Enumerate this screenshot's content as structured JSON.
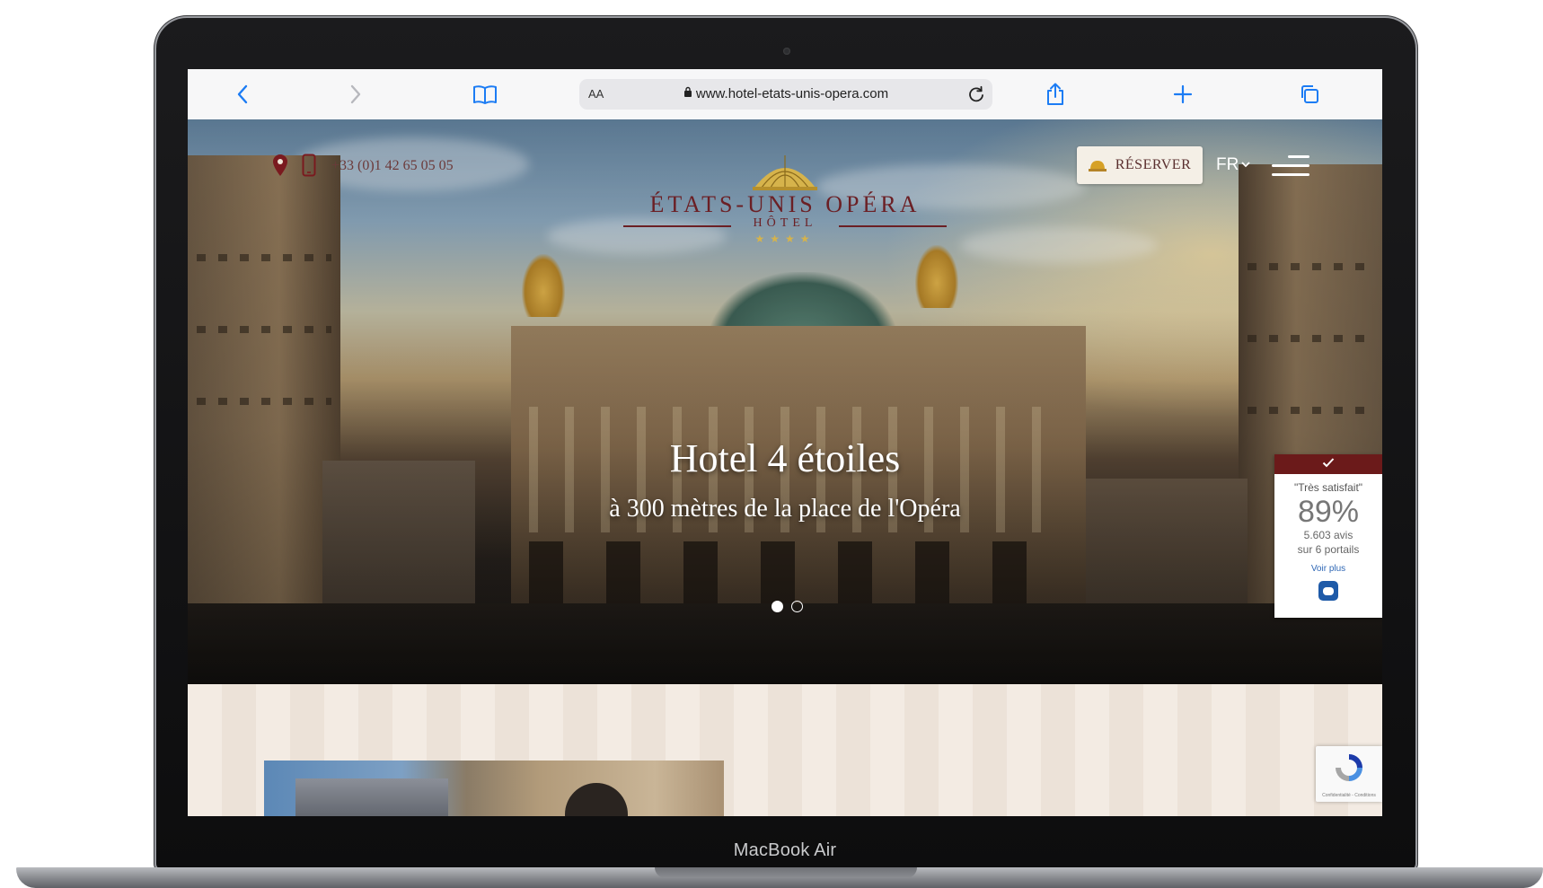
{
  "device": {
    "label": "MacBook Air"
  },
  "browser": {
    "text_size_label": "AA",
    "url": "www.hotel-etats-unis-opera.com",
    "icons": [
      "back-icon",
      "forward-icon",
      "bookmarks-icon",
      "lock-icon",
      "reload-icon",
      "share-icon",
      "new-tab-icon",
      "tabs-icon"
    ]
  },
  "header": {
    "phone": "+33 (0)1 42 65 05 05",
    "logo_title": "ÉTATS-UNIS OPÉRA",
    "logo_subtitle": "HÔTEL",
    "logo_stars": "★★★★",
    "book_label": "RÉSERVER",
    "language": "FR"
  },
  "hero": {
    "title": "Hotel 4 étoiles",
    "subtitle": "à 300 mètres de la place de l'Opéra",
    "slides": 2,
    "active_slide": 1
  },
  "rating_widget": {
    "label": "\"Très satisfait\"",
    "percent": "89%",
    "reviews": "5.603 avis",
    "portals": "sur 6 portails",
    "more_label": "Voir plus"
  },
  "recaptcha": {
    "text": "Confidentialité - Conditions"
  },
  "colors": {
    "browser_accent": "#1c7cf4",
    "brand_burgundy": "#6b1f24",
    "gold": "#d6b34b",
    "rating_header": "#6b1a1a"
  }
}
